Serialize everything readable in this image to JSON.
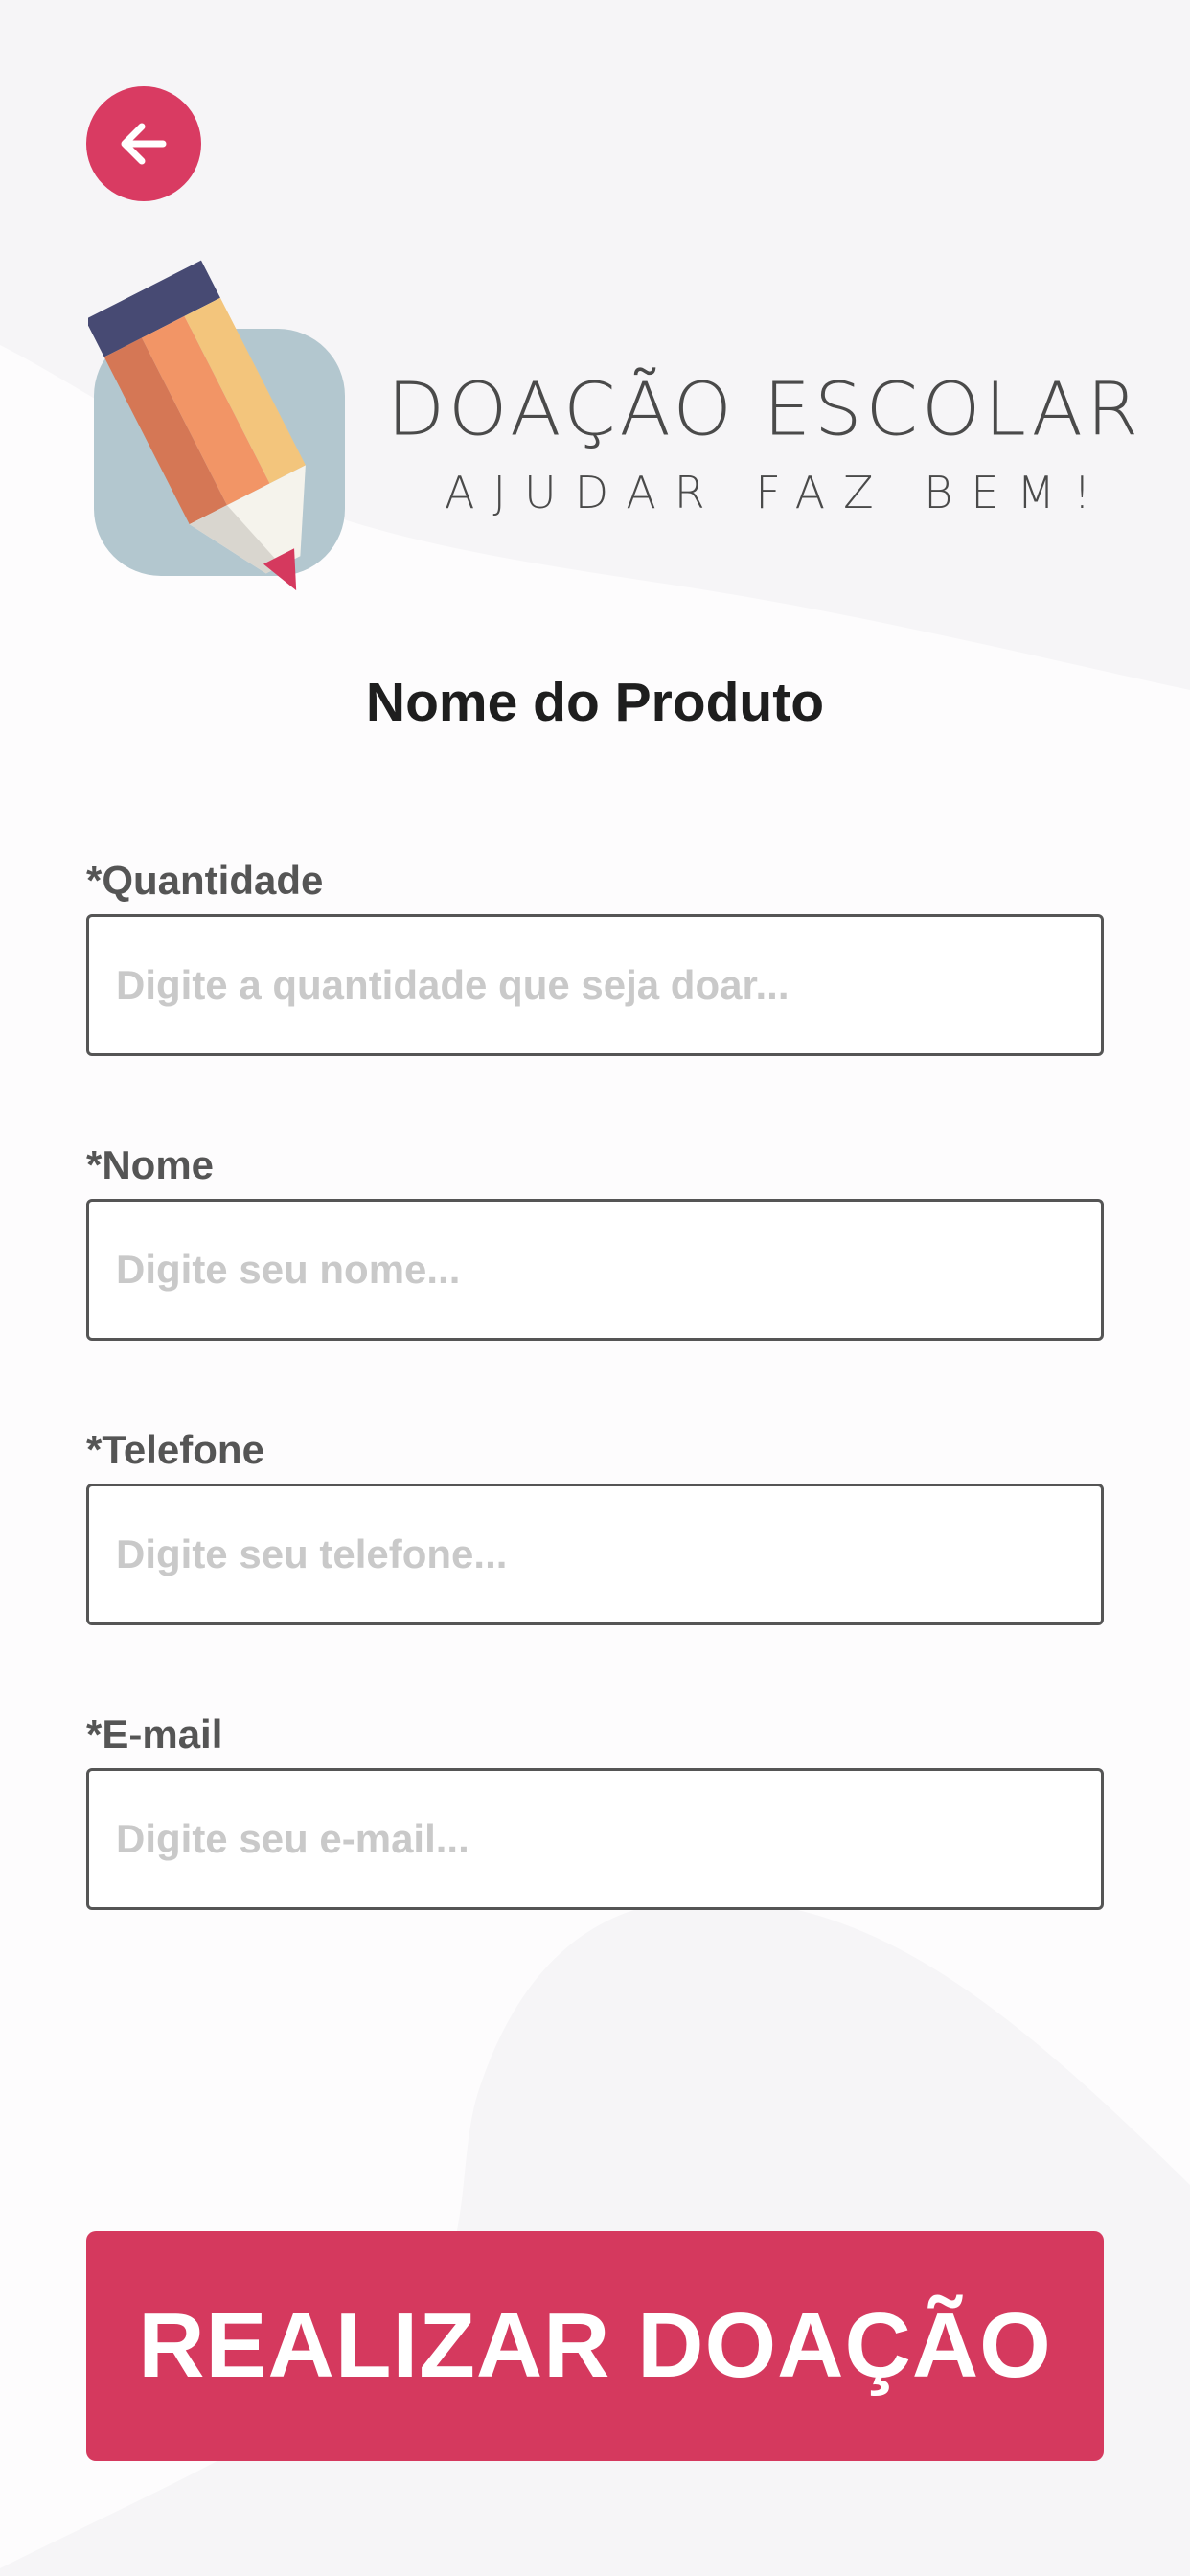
{
  "header": {
    "back_icon": "arrow-left-icon"
  },
  "logo": {
    "title": "DOAÇÃO ESCOLAR",
    "subtitle": "AJUDAR FAZ BEM!",
    "icon": "pencil-icon"
  },
  "page": {
    "title": "Nome do Produto"
  },
  "form": {
    "quantity": {
      "label": "*Quantidade",
      "placeholder": "Digite a quantidade que seja doar...",
      "value": ""
    },
    "name": {
      "label": "*Nome",
      "placeholder": "Digite seu nome...",
      "value": ""
    },
    "phone": {
      "label": "*Telefone",
      "placeholder": "Digite seu telefone...",
      "value": ""
    },
    "email": {
      "label": "*E-mail",
      "placeholder": "Digite seu e-mail...",
      "value": ""
    }
  },
  "actions": {
    "submit_label": "REALIZAR DOAÇÃO"
  },
  "colors": {
    "accent": "#d5395e",
    "text_dark": "#1e1e1e",
    "label": "#555555",
    "placeholder": "#c9c9c9",
    "background": "#fdfcfd"
  }
}
